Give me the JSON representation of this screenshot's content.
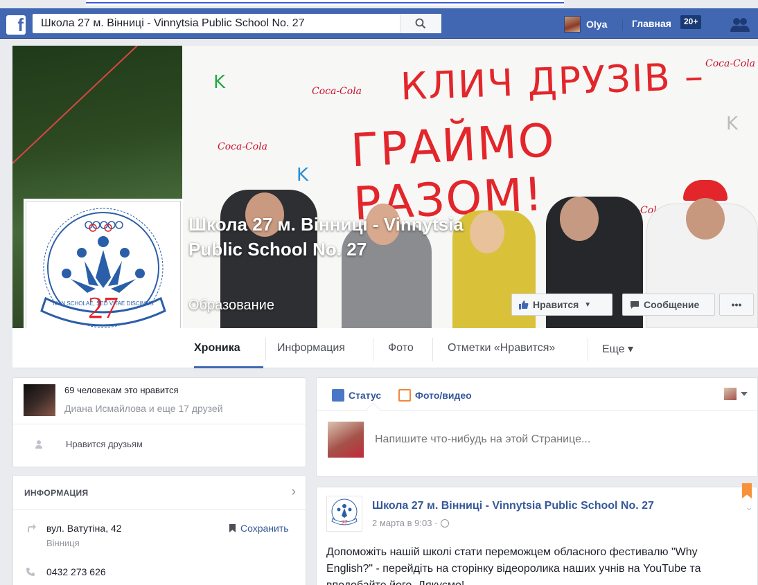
{
  "topbar": {
    "search_value": "Школа 27 м. Вінниці - Vinnytsia Public School No. 27",
    "user_name": "Olya",
    "home_label": "Главная",
    "notif_count": "20+"
  },
  "cover": {
    "headline_1": "КЛИЧ ДРУЗІВ –",
    "headline_2": "ГРАЙМО РАЗОМ!",
    "sponsor": "Coca-Cola",
    "page_title": "Школа 27 м. Вінниці - Vinnytsia Public School No. 27",
    "category": "Образование",
    "like_button": "Нравится",
    "message_button": "Сообщение",
    "more_button": "•••"
  },
  "logo": {
    "motto": "NON SCHOLAE, SED VITAE DISCIMUS",
    "number": "27"
  },
  "tabs": [
    {
      "label": "Хроника"
    },
    {
      "label": "Информация"
    },
    {
      "label": "Фото"
    },
    {
      "label": "Отметки «Нравится»"
    },
    {
      "label": "Еще ▾"
    }
  ],
  "likes_card": {
    "count_text": "69 человекам это нравится",
    "friends_text": "Диана Исмайлова и еще 17 друзей",
    "friends_like_label": "Нравится друзьям"
  },
  "info_card": {
    "heading": "ИНФОРМАЦИЯ",
    "address_line1": "вул. Ватутіна, 42",
    "address_line2": "Вінниця",
    "save_label": "Сохранить",
    "phone": "0432 273 626"
  },
  "composer": {
    "status_tab": "Статус",
    "photo_tab": "Фото/видео",
    "placeholder": "Напишите что-нибудь на этой Странице..."
  },
  "post": {
    "author": "Школа 27 м. Вінниці - Vinnytsia Public School No. 27",
    "time": "2 марта в 9:03 ·",
    "body": "Допоможіть нашій школі стати переможцем обласного фестивалю \"Why English?\" - перейдіть на сторінку відеоролика наших учнів на YouTube та вподобайте його. Дякуємо!"
  },
  "colors": {
    "fb_blue": "#4267b2",
    "link_blue": "#365899",
    "headline_red": "#e2262b",
    "background": "#e9ebee"
  }
}
